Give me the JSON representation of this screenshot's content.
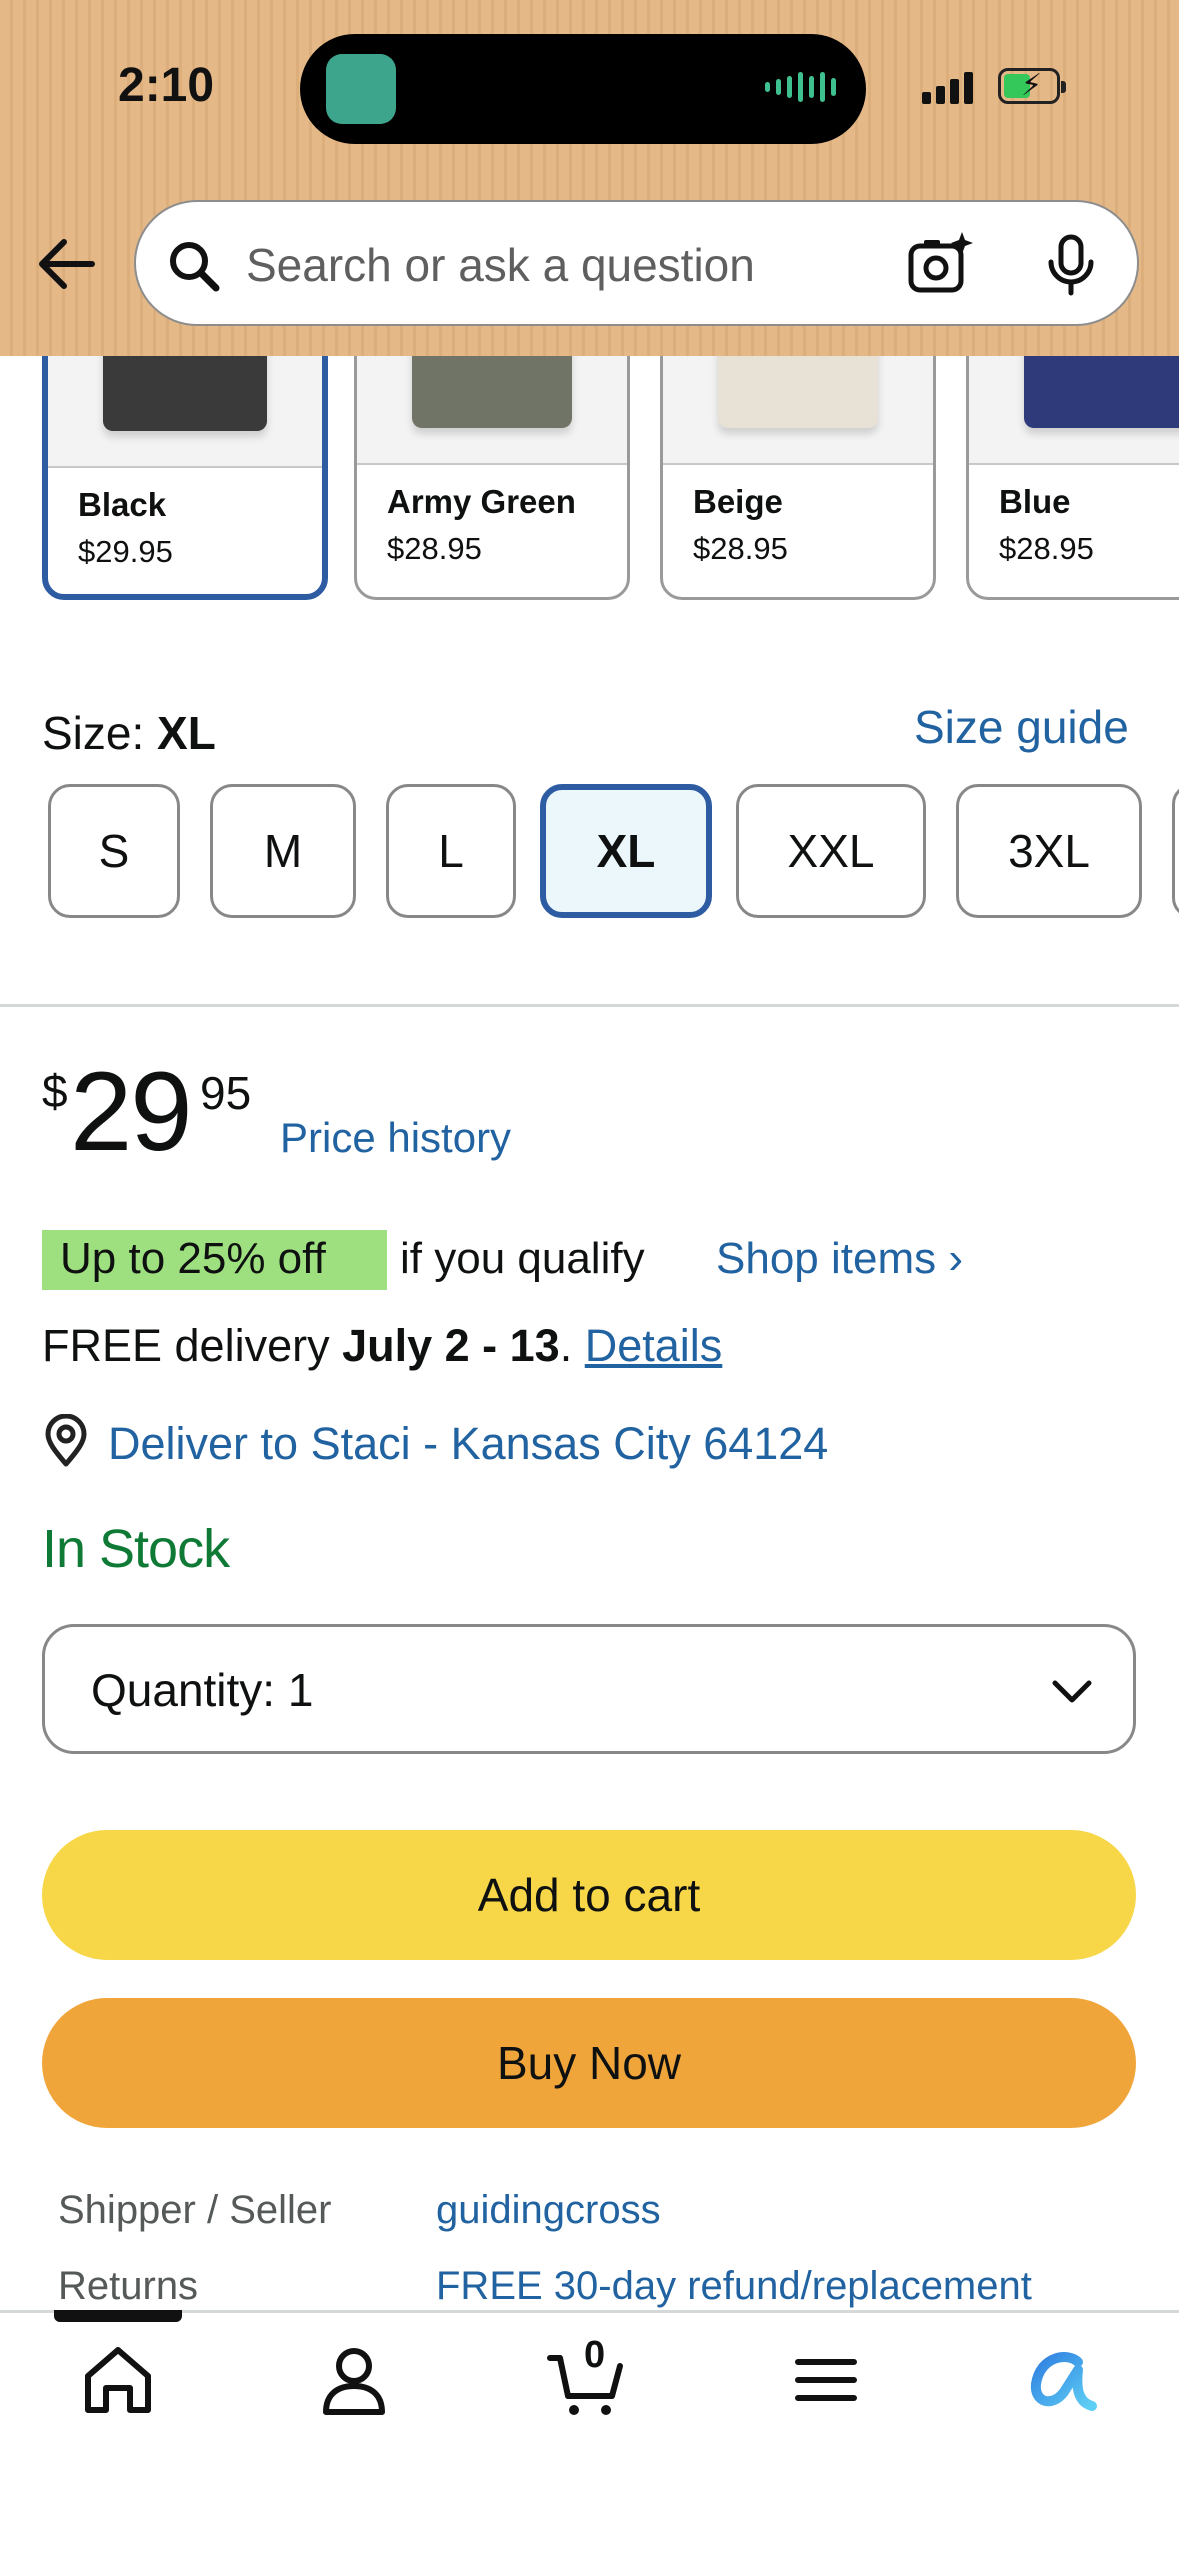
{
  "status_bar": {
    "time": "2:10"
  },
  "search": {
    "placeholder": "Search or ask a question"
  },
  "colors": {
    "items": [
      {
        "name": "Black",
        "price": "$29.95",
        "swatch": "#3a3a3a",
        "selected": true
      },
      {
        "name": "Army Green",
        "price": "$28.95",
        "swatch": "#6f7466",
        "selected": false
      },
      {
        "name": "Beige",
        "price": "$28.95",
        "swatch": "#e7e1d6",
        "selected": false
      },
      {
        "name": "Blue",
        "price": "$28.95",
        "swatch": "#2f3a7a",
        "selected": false
      }
    ]
  },
  "size": {
    "label": "Size: ",
    "value": "XL",
    "guide_link": "Size guide",
    "options": [
      "S",
      "M",
      "L",
      "XL",
      "XXL",
      "3XL"
    ]
  },
  "price": {
    "currency": "$",
    "whole": "29",
    "cents": "95",
    "history_link": "Price history"
  },
  "promo": {
    "badge": "Up to 25% off",
    "text": "if you qualify",
    "link": "Shop items ›"
  },
  "delivery": {
    "prefix": "FREE delivery ",
    "dates": "July 2 - 13",
    "separator": ". ",
    "details_link": "Details",
    "deliver_to": "Deliver to Staci - Kansas City 64124"
  },
  "stock": "In Stock",
  "quantity": {
    "label": "Quantity:  1"
  },
  "buttons": {
    "add_to_cart": "Add to cart",
    "buy_now": "Buy Now"
  },
  "info": {
    "shipper_label": "Shipper / Seller",
    "shipper_value": "guidingcross",
    "returns_label": "Returns",
    "returns_value": "FREE 30-day refund/replacement"
  },
  "bottom_nav": {
    "cart_count": "0",
    "items": [
      "home-icon",
      "account-icon",
      "cart-icon",
      "menu-icon",
      "rufus-icon"
    ]
  }
}
